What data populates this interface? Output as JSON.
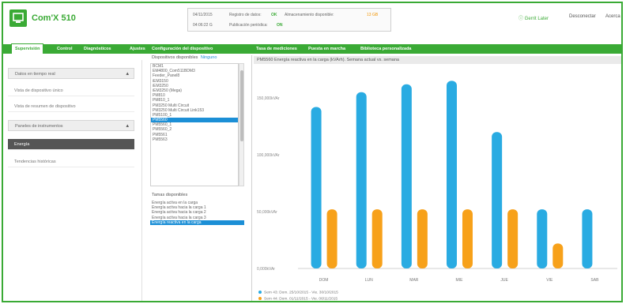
{
  "app": {
    "title": "Com'X 510",
    "brand_color": "#3aaa35"
  },
  "status": {
    "date": "04/11/2015",
    "time": "04:06:22 G",
    "registry_label": "Registro de datos:",
    "registry_value": "OK",
    "storage_label": "Almacenamiento disponible:",
    "storage_value": "13 GB",
    "publication_label": "Publicación periódica:",
    "publication_value": "ON"
  },
  "header_links": {
    "help": "Gerrit Later",
    "logout": "Desconectar",
    "about": "Acerca"
  },
  "tabs": [
    "Supervisión",
    "Control",
    "Diagnósticos",
    "Ajustes",
    "Configuración del dispositivo",
    "Tasa de mediciones",
    "Puesta en marcha",
    "Biblioteca personalizada"
  ],
  "sidebar": {
    "group1": {
      "label": "Datos en tiempo real"
    },
    "items1": [
      "Vista de dispositivo único",
      "Vista de resumen de dispositivo"
    ],
    "group2": {
      "label": "Paneles de instrumentos"
    },
    "items2": [
      "Energía",
      "Tendencias históricas"
    ]
  },
  "devices": {
    "title": "Dispositivos disponibles",
    "select_label": "Ninguno",
    "items": [
      "BCM1",
      "EM4800_Com511BDM3",
      "Feeder_Panel8",
      "iEM3150",
      "iEM3250",
      "iEM3250 (Mega)",
      "PM810",
      "PM810_1",
      "PM3250 Multi Circuit",
      "PM3250 Multi Circuit Link153",
      "PM5100_1",
      "PM5560",
      "PM5560_1",
      "PM5560_2",
      "PM5561",
      "PM5563"
    ],
    "selected_index": 11
  },
  "variables": {
    "title": "Tamas disponibles",
    "items": [
      "Energía activa en la carga",
      "Energía activa hacia la carga 1",
      "Energía activa hacia la carga 2",
      "Energía activa hacia la carga 3",
      "Energía reactiva en la carga"
    ],
    "selected_index": 4
  },
  "chart_title": "PM5560 Energía reactiva en la carga (kVArh). Semana actual vs. semana",
  "chart_data": {
    "type": "bar",
    "categories": [
      "DOM",
      "LUN",
      "MAR",
      "MIE",
      "JUE",
      "VIE",
      "SAB"
    ],
    "series": [
      {
        "name": "Sem 43: Dom. 25/10/2015 - Vie. 30/10/2015",
        "color": "#29abe2",
        "values": [
          142,
          155,
          162,
          165,
          120,
          52,
          52
        ]
      },
      {
        "name": "Sem 44: Dom. 01/11/2015 - Vie. 06/11/2015",
        "color": "#f7a11a",
        "values": [
          52,
          52,
          52,
          52,
          52,
          22,
          null
        ]
      }
    ],
    "y_ticks": [
      "0,000kVAr",
      "50,000kVAr",
      "100,000kVAr",
      "150,000kVAr"
    ],
    "ylim": [
      0,
      175
    ],
    "grid": false
  }
}
